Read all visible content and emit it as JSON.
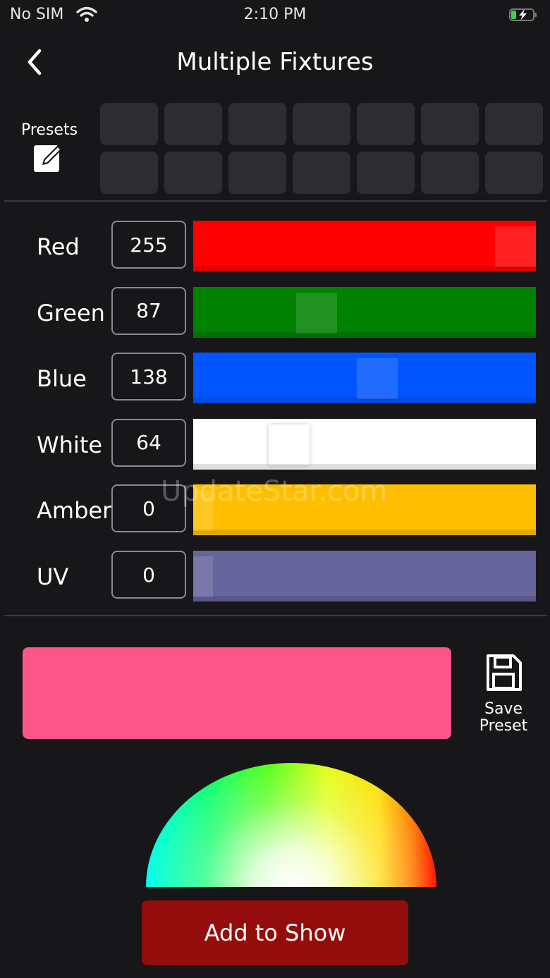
{
  "status_bar": {
    "carrier": "No SIM",
    "time": "2:10 PM"
  },
  "nav": {
    "title": "Multiple Fixtures"
  },
  "presets": {
    "label": "Presets",
    "slots": 14
  },
  "channels": [
    {
      "id": "red",
      "label": "Red",
      "value": "255",
      "level": 1.0,
      "color": "#ff0000"
    },
    {
      "id": "green",
      "label": "Green",
      "value": "87",
      "level": 0.341,
      "color": "#008100"
    },
    {
      "id": "blue",
      "label": "Blue",
      "value": "138",
      "level": 0.541,
      "color": "#0055ff"
    },
    {
      "id": "white",
      "label": "White",
      "value": "64",
      "level": 0.251,
      "color": "#ffffff"
    },
    {
      "id": "amber",
      "label": "Amber",
      "value": "0",
      "level": 0.0,
      "color": "#ffbf00"
    },
    {
      "id": "uv",
      "label": "UV",
      "value": "0",
      "level": 0.0,
      "color": "#67659c"
    }
  ],
  "preview": {
    "color": "#fd568a"
  },
  "save_preset": {
    "line1": "Save",
    "line2": "Preset"
  },
  "add_to_show": {
    "label": "Add to Show"
  },
  "watermark": "UpdateStar.com"
}
